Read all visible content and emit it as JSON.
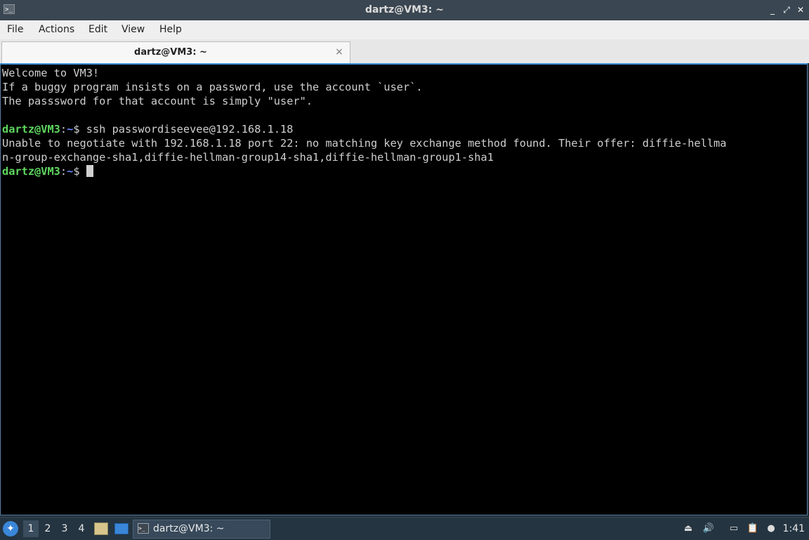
{
  "window": {
    "title": "dartz@VM3: ~",
    "icon": "terminal-icon",
    "controls": [
      "minimize",
      "maximize",
      "close"
    ]
  },
  "menu": [
    "File",
    "Actions",
    "Edit",
    "View",
    "Help"
  ],
  "tab": {
    "label": "dartz@VM3: ~",
    "close": "×"
  },
  "terminal": {
    "motd": [
      "Welcome to VM3!",
      "If a buggy program insists on a password, use the account `user`.",
      "The passsword for that account is simply \"user\"."
    ],
    "prompt": {
      "user": "dartz@VM3",
      "sep": ":",
      "path": "~",
      "symbol": "$ "
    },
    "command": "ssh passwordiseevee@192.168.1.18",
    "output": [
      "Unable to negotiate with 192.168.1.18 port 22: no matching key exchange method found. Their offer: diffie-hellma",
      "n-group-exchange-sha1,diffie-hellman-group14-sha1,diffie-hellman-group1-sha1"
    ]
  },
  "taskbar": {
    "desktops": [
      "1",
      "2",
      "3",
      "4"
    ],
    "active_desktop": "1",
    "task_label": "dartz@VM3: ~",
    "clock": "1:41",
    "tray_icons": [
      "eject-icon",
      "volume-icon",
      "network-icon",
      "clipboard-icon",
      "notification-icon"
    ]
  }
}
